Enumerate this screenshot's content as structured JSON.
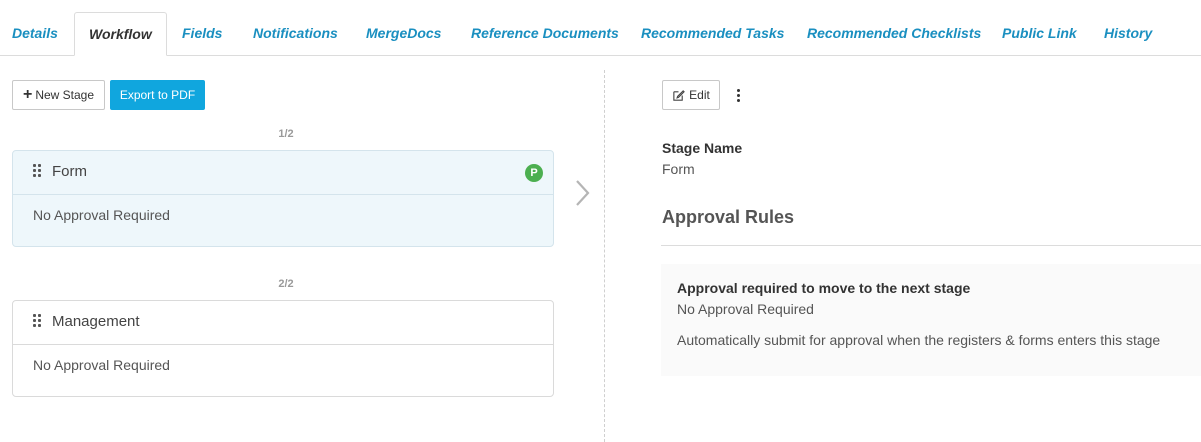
{
  "tabs": [
    {
      "label": "Details",
      "active": false
    },
    {
      "label": "Workflow",
      "active": true
    },
    {
      "label": "Fields",
      "active": false
    },
    {
      "label": "Notifications",
      "active": false
    },
    {
      "label": "MergeDocs",
      "active": false
    },
    {
      "label": "Reference Documents",
      "active": false
    },
    {
      "label": "Recommended Tasks",
      "active": false
    },
    {
      "label": "Recommended Checklists",
      "active": false
    },
    {
      "label": "Public Link",
      "active": false
    },
    {
      "label": "History",
      "active": false
    }
  ],
  "toolbar": {
    "new_stage_label": "New Stage",
    "export_label": "Export to PDF"
  },
  "stages": [
    {
      "counter": "1/2",
      "name": "Form",
      "approval": "No Approval Required",
      "badge": "P",
      "selected": true
    },
    {
      "counter": "2/2",
      "name": "Management",
      "approval": "No Approval Required",
      "selected": false
    }
  ],
  "detail": {
    "edit_label": "Edit",
    "stage_name_label": "Stage Name",
    "stage_name_value": "Form",
    "approval_rules_heading": "Approval Rules",
    "approval_required_label": "Approval required to move to the next stage",
    "approval_required_value": "No Approval Required",
    "auto_submit_text": "Automatically submit for approval when the registers & forms enters this stage"
  },
  "colors": {
    "tab_link": "#1a8fc0",
    "primary_button": "#10a6de",
    "badge": "#4caf50",
    "selected_card": "#eef7fb"
  },
  "icons": [
    "plus-icon",
    "drag-handle-icon",
    "chevron-right-icon",
    "edit-icon",
    "more-vertical-icon"
  ]
}
